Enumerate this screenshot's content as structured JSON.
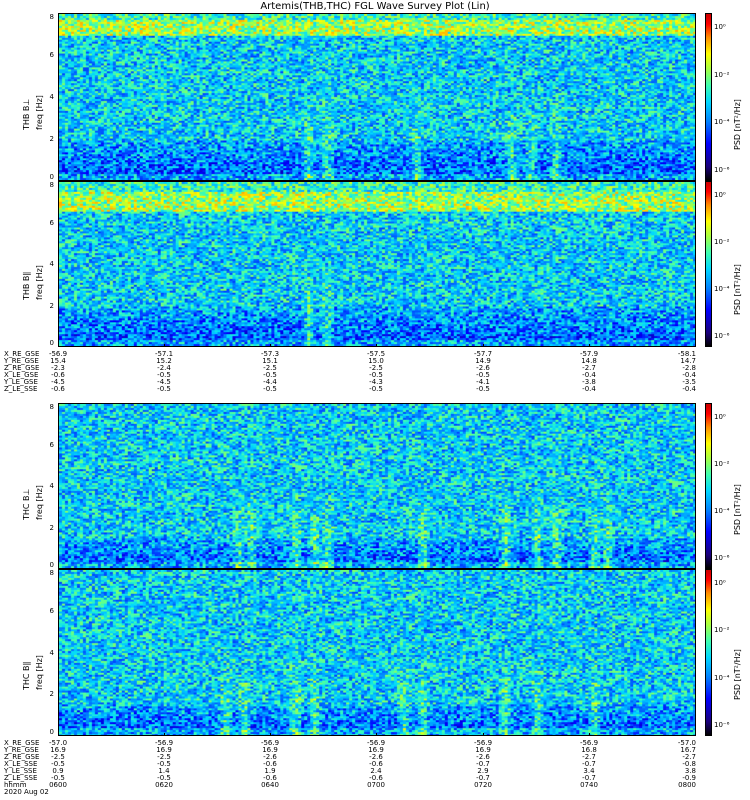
{
  "title": "Artemis(THB,THC) FGL Wave Survey Plot (Lin)",
  "colors": {
    "background": "#ffffff",
    "axis": "#000000"
  },
  "chart_data": [
    {
      "type": "heatmap",
      "id": "p1",
      "probe_label": "THB B⊥",
      "ylabel": "freq [Hz]",
      "ylim": [
        0,
        8
      ],
      "yticks": [
        0,
        2,
        4,
        6,
        8
      ],
      "colorbar_label": "PSD [nT²/Hz]",
      "colorbar_ticks": [
        "10⁰",
        "10⁻²",
        "10⁻⁴",
        "10⁻⁶"
      ],
      "noise_band_hz": [
        7.0,
        7.8
      ],
      "low_band_hz": [
        0,
        2
      ],
      "bursts_frac": [
        0.39,
        0.42,
        0.56,
        0.71,
        0.74,
        0.78
      ]
    },
    {
      "type": "heatmap",
      "id": "p2",
      "probe_label": "THB B∥",
      "ylabel": "freq [Hz]",
      "ylim": [
        0,
        8
      ],
      "yticks": [
        0,
        2,
        4,
        6,
        8
      ],
      "colorbar_label": "PSD [nT²/Hz]",
      "colorbar_ticks": [
        "10⁰",
        "10⁻²",
        "10⁻⁴",
        "10⁻⁶"
      ],
      "noise_band_hz": [
        6.6,
        7.6
      ],
      "low_band_hz": [
        0,
        2
      ],
      "bursts_frac": [
        0.39,
        0.42
      ]
    },
    {
      "type": "heatmap",
      "id": "p3",
      "probe_label": "THC B⊥",
      "ylabel": "freq [Hz]",
      "ylim": [
        0,
        8
      ],
      "yticks": [
        0,
        2,
        4,
        6,
        8
      ],
      "colorbar_label": "PSD [nT²/Hz]",
      "colorbar_ticks": [
        "10⁰",
        "10⁻²",
        "10⁻⁴",
        "10⁻⁶"
      ],
      "noise_band_hz": [],
      "low_band_hz": [
        0,
        1.5
      ],
      "bursts_frac": [
        0.28,
        0.3,
        0.37,
        0.4,
        0.42,
        0.57,
        0.7,
        0.75,
        0.78,
        0.84,
        0.86
      ]
    },
    {
      "type": "heatmap",
      "id": "p4",
      "probe_label": "THC B∥",
      "ylabel": "freq [Hz]",
      "ylim": [
        0,
        8
      ],
      "yticks": [
        0,
        2,
        4,
        6,
        8
      ],
      "colorbar_label": "PSD [nT²/Hz]",
      "colorbar_ticks": [
        "10⁰",
        "10⁻²",
        "10⁻⁴",
        "10⁻⁶"
      ],
      "noise_band_hz": [],
      "low_band_hz": [
        0,
        1.5
      ],
      "bursts_frac": [
        0.26,
        0.29,
        0.37,
        0.4,
        0.54,
        0.57,
        0.7,
        0.75,
        0.84
      ]
    }
  ],
  "ephem_thb": {
    "rows": [
      {
        "label": "X_RE_GSE",
        "values": [
          "-56.9",
          "-57.1",
          "-57.3",
          "-57.5",
          "-57.7",
          "-57.9",
          "-58.1"
        ]
      },
      {
        "label": "Y_RE_GSE",
        "values": [
          "15.4",
          "15.2",
          "15.1",
          "15.0",
          "14.9",
          "14.8",
          "14.7"
        ]
      },
      {
        "label": "Z_RE_GSE",
        "values": [
          "-2.3",
          "-2.4",
          "-2.5",
          "-2.5",
          "-2.6",
          "-2.7",
          "-2.8"
        ]
      },
      {
        "label": "X_LE_GSE",
        "values": [
          "-0.6",
          "-0.5",
          "-0.5",
          "-0.5",
          "-0.5",
          "-0.4",
          "-0.4"
        ]
      },
      {
        "label": "Y_LE_GSE",
        "values": [
          "-4.5",
          "-4.5",
          "-4.4",
          "-4.3",
          "-4.1",
          "-3.8",
          "-3.5"
        ]
      },
      {
        "label": "Z_LE_SSE",
        "values": [
          "-0.6",
          "-0.5",
          "-0.5",
          "-0.5",
          "-0.5",
          "-0.4",
          "-0.4"
        ]
      }
    ]
  },
  "ephem_thc": {
    "rows": [
      {
        "label": "X_RE_GSE",
        "values": [
          "-57.0",
          "-56.9",
          "-56.9",
          "-56.9",
          "-56.9",
          "-56.9",
          "-57.0"
        ]
      },
      {
        "label": "Y_RE_GSE",
        "values": [
          "16.9",
          "16.9",
          "16.9",
          "16.9",
          "16.9",
          "16.8",
          "16.7"
        ]
      },
      {
        "label": "Z_RE_GSE",
        "values": [
          "-2.5",
          "-2.5",
          "-2.6",
          "-2.6",
          "-2.6",
          "-2.7",
          "-2.7"
        ]
      },
      {
        "label": "X_LE_SSE",
        "values": [
          "-0.5",
          "-0.5",
          "-0.6",
          "-0.6",
          "-0.7",
          "-0.7",
          "-0.8"
        ]
      },
      {
        "label": "Y_LE_SSE",
        "values": [
          "0.9",
          "1.4",
          "1.9",
          "2.4",
          "2.9",
          "3.4",
          "3.8"
        ]
      },
      {
        "label": "Z_LE_SSE",
        "values": [
          "-0.5",
          "-0.5",
          "-0.6",
          "-0.6",
          "-0.7",
          "-0.7",
          "-0.9"
        ]
      },
      {
        "label": "hhmm",
        "values": [
          "0600",
          "0620",
          "0640",
          "0700",
          "0720",
          "0740",
          "0800"
        ]
      }
    ],
    "date": "2020 Aug 02"
  }
}
